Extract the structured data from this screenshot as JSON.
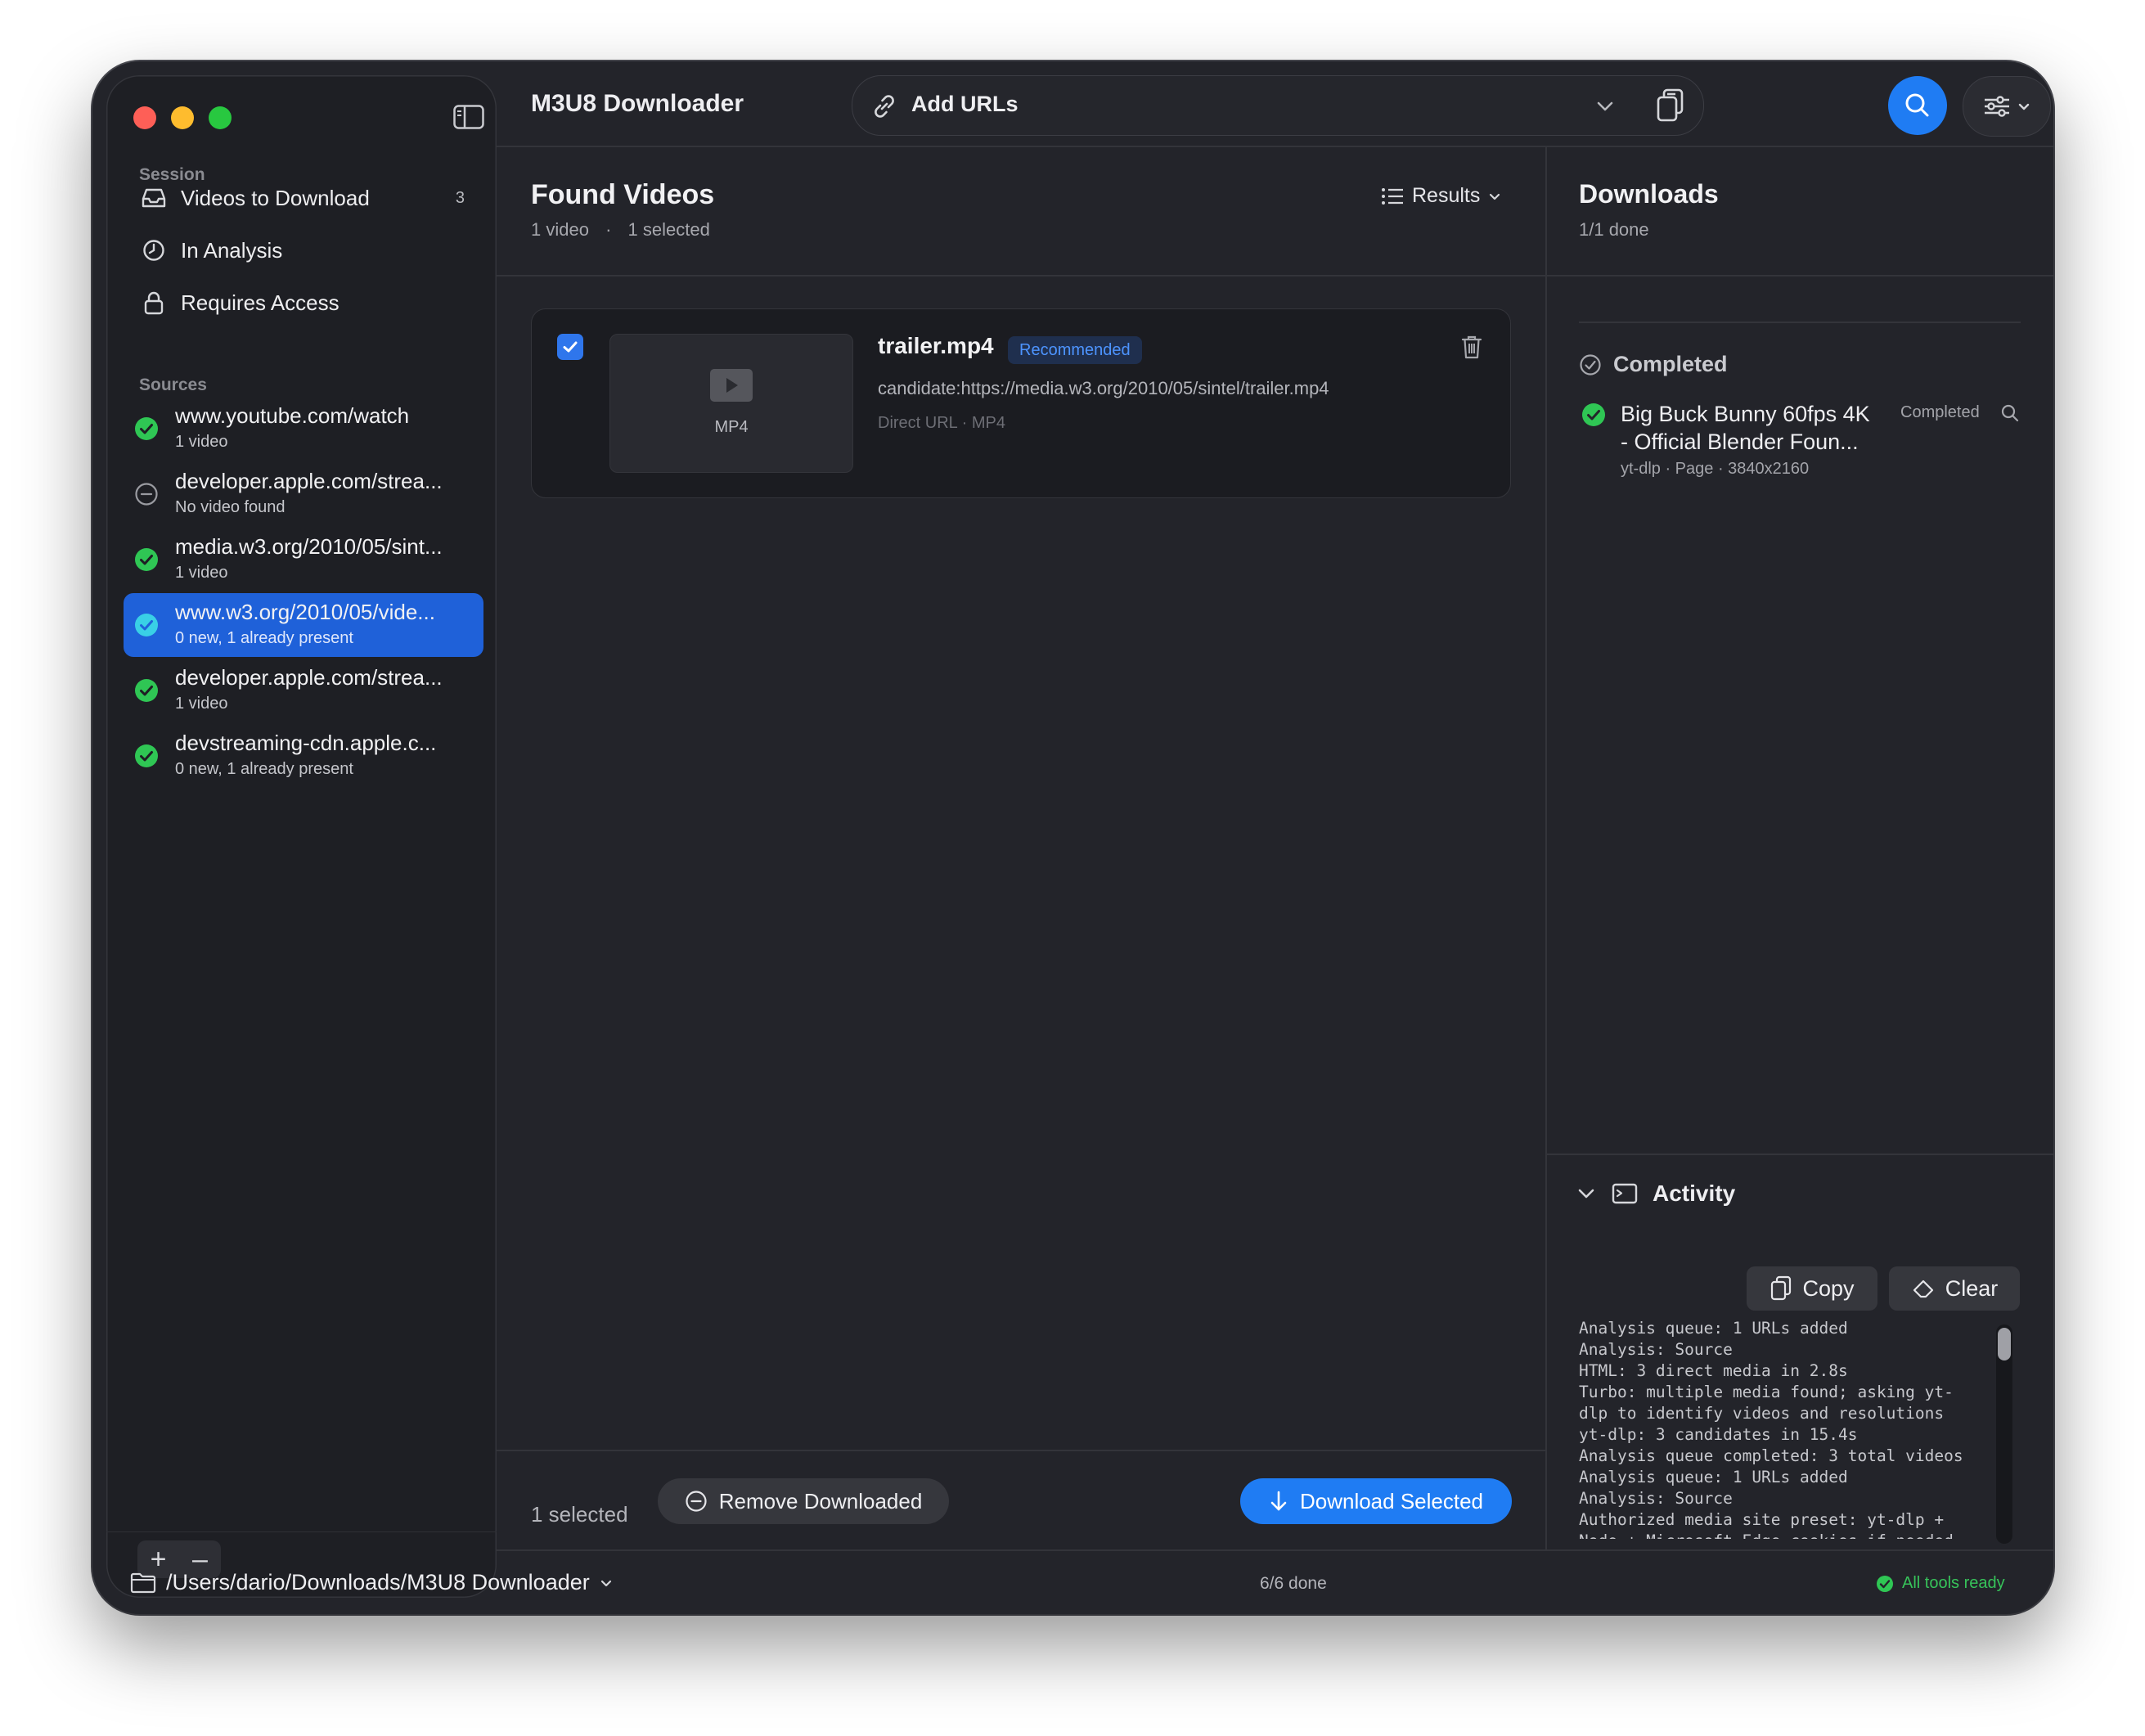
{
  "app": {
    "title": "M3U8 Downloader"
  },
  "toolbar": {
    "add_urls_label": "Add URLs"
  },
  "sidebar": {
    "session_heading": "Session",
    "session_items": [
      {
        "label": "Videos to Download",
        "count": "3",
        "icon": "tray-icon"
      },
      {
        "label": "In Analysis",
        "count": "",
        "icon": "clock-icon"
      },
      {
        "label": "Requires Access",
        "count": "",
        "icon": "lock-icon"
      }
    ],
    "sources_heading": "Sources",
    "sources": [
      {
        "name": "www.youtube.com/watch",
        "status": "1 video",
        "state": "ok"
      },
      {
        "name": "developer.apple.com/strea...",
        "status": "No video found",
        "state": "none"
      },
      {
        "name": "media.w3.org/2010/05/sint...",
        "status": "1 video",
        "state": "ok"
      },
      {
        "name": "www.w3.org/2010/05/vide...",
        "status": "0 new, 1 already present",
        "state": "ok",
        "selected": true
      },
      {
        "name": "developer.apple.com/strea...",
        "status": "1 video",
        "state": "ok"
      },
      {
        "name": "devstreaming-cdn.apple.c...",
        "status": "0 new, 1 already present",
        "state": "ok"
      }
    ],
    "add_label": "+",
    "remove_label": "–"
  },
  "found": {
    "title": "Found Videos",
    "video_count": "1 video",
    "separator": "·",
    "selected_count": "1 selected",
    "results_label": "Results",
    "items": [
      {
        "filename": "trailer.mp4",
        "badge": "Recommended",
        "url": "candidate:https://media.w3.org/2010/05/sintel/trailer.mp4",
        "meta": "Direct URL · MP4",
        "format": "MP4",
        "checked": true
      }
    ],
    "footer_selected": "1 selected",
    "remove_downloaded_label": "Remove Downloaded",
    "download_selected_label": "Download Selected"
  },
  "downloads": {
    "title": "Downloads",
    "subtitle": "1/1 done",
    "group_completed": "Completed",
    "items": [
      {
        "name": "Big Buck Bunny 60fps 4K - Official Blender Foun...",
        "meta": "yt-dlp · Page · 3840x2160",
        "status": "Completed"
      }
    ]
  },
  "activity": {
    "title": "Activity",
    "copy_label": "Copy",
    "clear_label": "Clear",
    "log_lines": [
      "Analysis queue: 1 URLs added",
      "Analysis: Source",
      "HTML: 3 direct media in 2.8s",
      "Turbo: multiple media found; asking yt-",
      "dlp to identify videos and resolutions",
      "yt-dlp: 3 candidates in 15.4s",
      "Analysis queue completed: 3 total videos",
      "Analysis queue: 1 URLs added",
      "Analysis: Source",
      "Authorized media site preset: yt-dlp +",
      "Node + Microsoft Edge cookies if needed"
    ]
  },
  "footer": {
    "path": "/Users/dario/Downloads/M3U8 Downloader",
    "progress": "6/6 done",
    "tools_status": "All tools ready"
  },
  "colors": {
    "accent": "#1f7cf3",
    "success": "#2fc654",
    "selection": "#1f61d9",
    "badge_text": "#4d94ff"
  }
}
